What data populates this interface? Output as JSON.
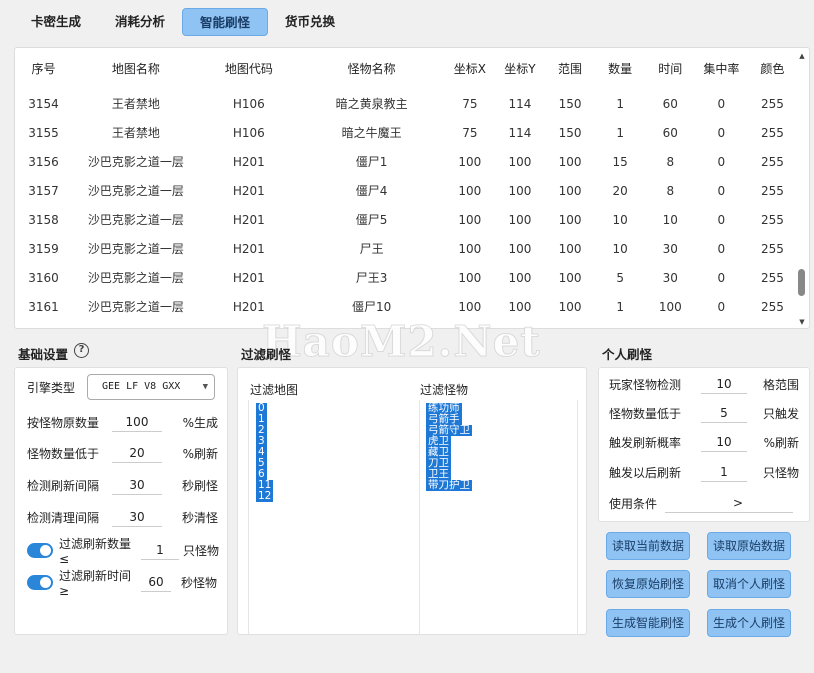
{
  "tabs": [
    "卡密生成",
    "消耗分析",
    "智能刷怪",
    "货币兑换"
  ],
  "table": {
    "headers": [
      "序号",
      "地图名称",
      "地图代码",
      "怪物名称",
      "坐标X",
      "坐标Y",
      "范围",
      "数量",
      "时间",
      "集中率",
      "颜色"
    ],
    "partial_row": [
      "",
      "",
      "H106",
      "",
      "75",
      "",
      "",
      "",
      "",
      "",
      ""
    ],
    "rows": [
      [
        "3154",
        "王者禁地",
        "H106",
        "暗之黄泉教主",
        "75",
        "114",
        "150",
        "1",
        "60",
        "0",
        "255"
      ],
      [
        "3155",
        "王者禁地",
        "H106",
        "暗之牛魔王",
        "75",
        "114",
        "150",
        "1",
        "60",
        "0",
        "255"
      ],
      [
        "3156",
        "沙巴克影之道一层",
        "H201",
        "僵尸1",
        "100",
        "100",
        "100",
        "15",
        "8",
        "0",
        "255"
      ],
      [
        "3157",
        "沙巴克影之道一层",
        "H201",
        "僵尸4",
        "100",
        "100",
        "100",
        "20",
        "8",
        "0",
        "255"
      ],
      [
        "3158",
        "沙巴克影之道一层",
        "H201",
        "僵尸5",
        "100",
        "100",
        "100",
        "10",
        "10",
        "0",
        "255"
      ],
      [
        "3159",
        "沙巴克影之道一层",
        "H201",
        "尸王",
        "100",
        "100",
        "100",
        "10",
        "30",
        "0",
        "255"
      ],
      [
        "3160",
        "沙巴克影之道一层",
        "H201",
        "尸王3",
        "100",
        "100",
        "100",
        "5",
        "30",
        "0",
        "255"
      ],
      [
        "3161",
        "沙巴克影之道一层",
        "H201",
        "僵尸10",
        "100",
        "100",
        "100",
        "1",
        "100",
        "0",
        "255"
      ]
    ]
  },
  "watermark": "HaoM2.Net",
  "basic": {
    "title": "基础设置",
    "help_icon": "?",
    "engine_label": "引擎类型",
    "engine_value": "GEE LF V8 GXX",
    "fields": [
      {
        "label": "按怪物原数量",
        "value": "100",
        "unit": "%生成"
      },
      {
        "label": "怪物数量低于",
        "value": "20",
        "unit": "%刷新"
      },
      {
        "label": "检测刷新间隔",
        "value": "30",
        "unit": "秒刷怪"
      },
      {
        "label": "检测清理间隔",
        "value": "30",
        "unit": "秒清怪"
      }
    ],
    "toggles": [
      {
        "label": "过滤刷新数量≤",
        "value": "1",
        "unit": "只怪物"
      },
      {
        "label": "过滤刷新时间≥",
        "value": "60",
        "unit": "秒怪物"
      }
    ]
  },
  "filter": {
    "title": "过滤刷怪",
    "map_title": "过滤地图",
    "monster_title": "过滤怪物",
    "maps": [
      "0",
      "1",
      "2",
      "3",
      "4",
      "5",
      "6",
      "11",
      "12"
    ],
    "monsters": [
      "练功师",
      "弓箭手",
      "弓箭守卫",
      "虎卫",
      "藏卫",
      "刀卫",
      "卫王",
      "带刀护卫"
    ]
  },
  "personal": {
    "title": "个人刷怪",
    "fields": [
      {
        "label": "玩家怪物检测",
        "value": "10",
        "unit": "格范围"
      },
      {
        "label": "怪物数量低于",
        "value": "5",
        "unit": "只触发"
      },
      {
        "label": "触发刷新概率",
        "value": "10",
        "unit": "%刷新"
      },
      {
        "label": "触发以后刷新",
        "value": "1",
        "unit": "只怪物"
      }
    ],
    "condition_label": "使用条件",
    "condition_arrow": ">"
  },
  "buttons": [
    "读取当前数据",
    "读取原始数据",
    "恢复原始刷怪",
    "取消个人刷怪",
    "生成智能刷怪",
    "生成个人刷怪"
  ],
  "colors": {
    "accent": "#8fc3f3",
    "selection": "#1e78d6",
    "toggle_on": "#2a86d8"
  }
}
